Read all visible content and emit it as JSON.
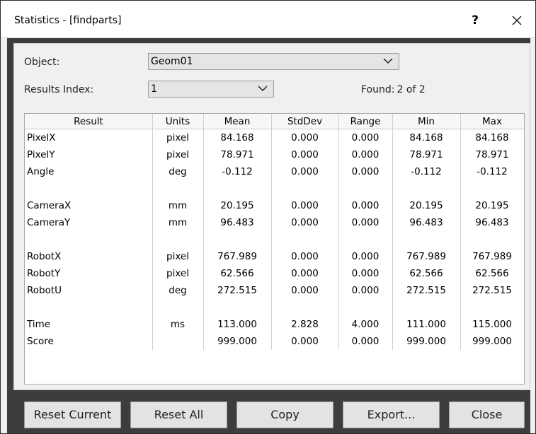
{
  "window": {
    "title": "Statistics - [findparts]",
    "help_label": "?"
  },
  "object": {
    "label": "Object:",
    "value": "Geom01"
  },
  "results_index": {
    "label": "Results Index:",
    "value": "1"
  },
  "found": {
    "label": "Found:",
    "value": "2 of 2"
  },
  "table": {
    "headers": [
      "Result",
      "Units",
      "Mean",
      "StdDev",
      "Range",
      "Min",
      "Max"
    ],
    "rows": [
      [
        "PixelX",
        "pixel",
        "84.168",
        "0.000",
        "0.000",
        "84.168",
        "84.168"
      ],
      [
        "PixelY",
        "pixel",
        "78.971",
        "0.000",
        "0.000",
        "78.971",
        "78.971"
      ],
      [
        "Angle",
        "deg",
        "-0.112",
        "0.000",
        "0.000",
        "-0.112",
        "-0.112"
      ],
      [
        "",
        "",
        "",
        "",
        "",
        "",
        ""
      ],
      [
        "CameraX",
        "mm",
        "20.195",
        "0.000",
        "0.000",
        "20.195",
        "20.195"
      ],
      [
        "CameraY",
        "mm",
        "96.483",
        "0.000",
        "0.000",
        "96.483",
        "96.483"
      ],
      [
        "",
        "",
        "",
        "",
        "",
        "",
        ""
      ],
      [
        "RobotX",
        "pixel",
        "767.989",
        "0.000",
        "0.000",
        "767.989",
        "767.989"
      ],
      [
        "RobotY",
        "pixel",
        "62.566",
        "0.000",
        "0.000",
        "62.566",
        "62.566"
      ],
      [
        "RobotU",
        "deg",
        "272.515",
        "0.000",
        "0.000",
        "272.515",
        "272.515"
      ],
      [
        "",
        "",
        "",
        "",
        "",
        "",
        ""
      ],
      [
        "Time",
        "ms",
        "113.000",
        "2.828",
        "4.000",
        "111.000",
        "115.000"
      ],
      [
        "Score",
        "",
        "999.000",
        "0.000",
        "0.000",
        "999.000",
        "999.000"
      ]
    ]
  },
  "buttons": {
    "reset_current": "Reset Current",
    "reset_all": "Reset All",
    "copy": "Copy",
    "export": "Export...",
    "close": "Close"
  }
}
